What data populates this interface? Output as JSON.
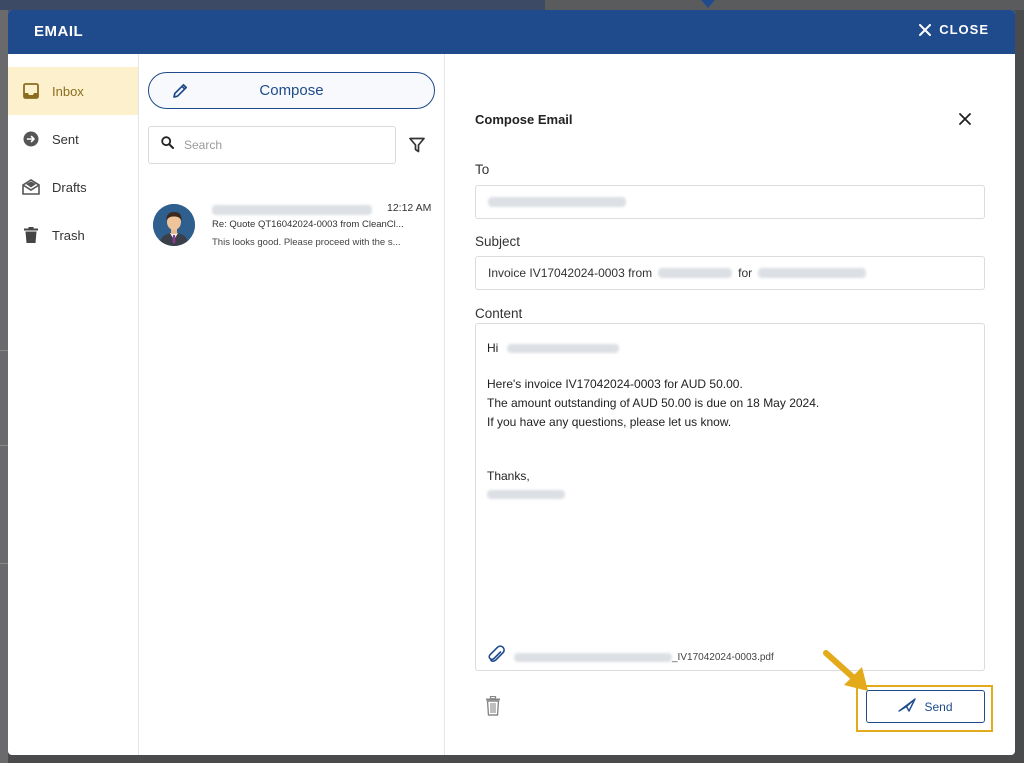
{
  "modal": {
    "title": "EMAIL",
    "close_label": "CLOSE"
  },
  "folders": [
    {
      "label": "Inbox",
      "icon": "inbox-icon",
      "active": true
    },
    {
      "label": "Sent",
      "icon": "sent-icon",
      "active": false
    },
    {
      "label": "Drafts",
      "icon": "drafts-icon",
      "active": false
    },
    {
      "label": "Trash",
      "icon": "trash-icon",
      "active": false
    }
  ],
  "message_list": {
    "compose_label": "Compose",
    "search_placeholder": "Search",
    "messages": [
      {
        "time": "12:12 AM",
        "subject": "Re: Quote QT16042024-0003 from CleanCl...",
        "preview": "This looks good. Please proceed with the s..."
      }
    ]
  },
  "compose": {
    "title": "Compose Email",
    "to_label": "To",
    "subject_label": "Subject",
    "subject_prefix": "Invoice IV17042024-0003 from",
    "subject_for": "for",
    "content_label": "Content",
    "greeting": "Hi",
    "lines": [
      "Here's invoice IV17042024-0003 for AUD 50.00.",
      "The amount outstanding of AUD 50.00 is due on 18 May 2024.",
      "If you have any questions, please let us know."
    ],
    "signoff": "Thanks,",
    "attachment_suffix": "_IV17042024-0003.pdf",
    "send_label": "Send"
  },
  "colors": {
    "header": "#1f4b8c",
    "active_folder_bg": "#fdf1cd",
    "highlight": "#e3aa1a"
  }
}
